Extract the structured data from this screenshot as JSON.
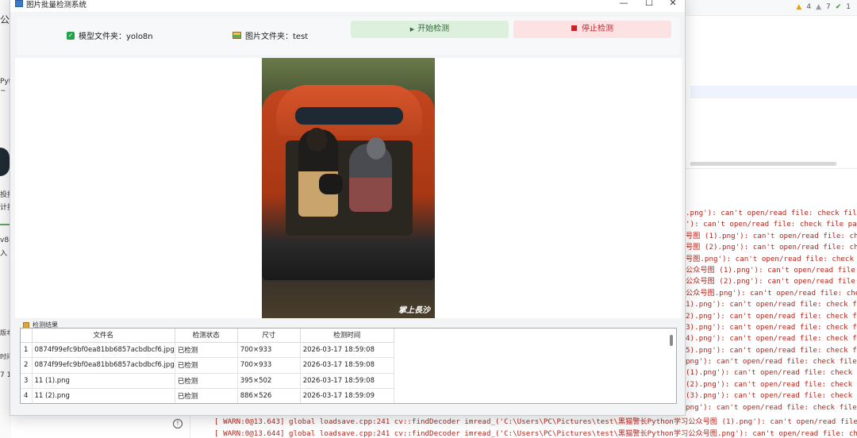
{
  "ide": {
    "left_fragments": [
      "公",
      "Pyt",
      "~",
      "投拆",
      "计批",
      "v8r",
      "入",
      "版本",
      "时间",
      "7 1"
    ],
    "inspections": {
      "warnings": "4",
      "weak_warnings": "7",
      "ok": "1"
    },
    "console_lines": [
      ".png'): can't open/read file: check file",
      "'): can't open/read file: check file path",
      "号图 (1).png'): can't open/read file: check",
      "号图 (2).png'): can't open/read file: check",
      "号图.png'): can't open/read file: check fil",
      "公众号图 (1).png'): can't open/read file: ch",
      "公众号图 (2).png'): can't open/read file: ch",
      "公众号图.png'): can't open/read file: check",
      "1).png'): can't open/read file: check file",
      "2).png'): can't open/read file: check file",
      "3).png'): can't open/read file: check file",
      "4).png'): can't open/read file: check file",
      "5).png'): can't open/read file: check file",
      "png'): can't open/read file: check file pat",
      " (1).png'): can't open/read file: check fil",
      " (2).png'): can't open/read file: check fil",
      " (3).png'): can't open/read file: check fil",
      "png'): can't open/read file: check file p"
    ],
    "bottom_lines": [
      "[ WARN:0@13.643] global loadsave.cpp:241 cv::findDecoder imread_('C:\\Users\\PC\\Pictures\\test\\黑猫警长Python学习公众号图 (1).png'): can't open/read file: check f",
      "[ WARN:0@13.644] global loadsave.cpp:241 cv::findDecoder imread_('C:\\Users\\PC\\Pictures\\test\\黑猫警长Python学习公众号图.png'): can't open/read file: check file"
    ]
  },
  "window": {
    "title": "图片批量检测系统",
    "controls": {
      "minimize": "—",
      "maximize": "☐",
      "close": "✕"
    }
  },
  "toolbar": {
    "model_label": "模型文件夹：yolo8n",
    "image_label": "图片文件夹：test",
    "start_button": "开始检测",
    "stop_button": "停止检测"
  },
  "preview": {
    "watermark": "掌上長沙"
  },
  "results": {
    "section_title": "检测结果",
    "columns": [
      "文件名",
      "检测状态",
      "尺寸",
      "检测时间"
    ],
    "rows": [
      {
        "num": "1",
        "file": "0874f99efc9bf0ea81bb6857acbdbcf6.jpg",
        "status": "已检测",
        "size": "700×933",
        "time": "2026-03-17 18:59:08"
      },
      {
        "num": "2",
        "file": "0874f99efc9bf0ea81bb6857acbdbcf6.jpg",
        "status": "已检测",
        "size": "700×933",
        "time": "2026-03-17 18:59:08"
      },
      {
        "num": "3",
        "file": "11 (1).png",
        "status": "已检测",
        "size": "395×502",
        "time": "2026-03-17 18:59:08"
      },
      {
        "num": "4",
        "file": "11 (2).png",
        "status": "已检测",
        "size": "886×526",
        "time": "2026-03-17 18:59:09"
      }
    ]
  }
}
